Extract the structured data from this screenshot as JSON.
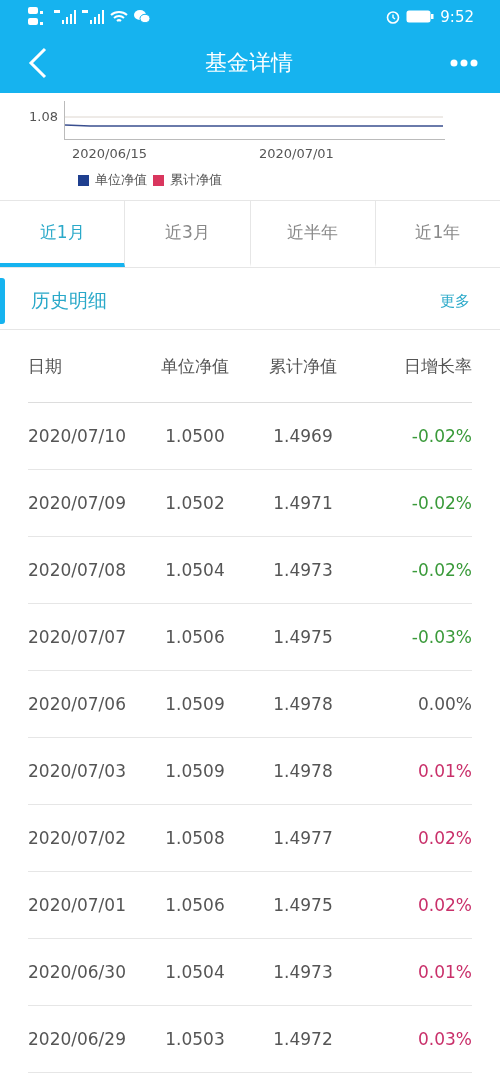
{
  "status_bar": {
    "time": "9:52"
  },
  "header": {
    "title": "基金详情"
  },
  "chart": {
    "y_tick": "1.08",
    "x_labels": [
      "2020/06/15",
      "2020/07/01"
    ],
    "legend": [
      {
        "label": "单位净值",
        "color": "#1f3f8f"
      },
      {
        "label": "累计净值",
        "color": "#d9365e"
      }
    ]
  },
  "tabs": [
    {
      "label": "近1月",
      "selected": true
    },
    {
      "label": "近3月",
      "selected": false
    },
    {
      "label": "近半年",
      "selected": false
    },
    {
      "label": "近1年",
      "selected": false
    }
  ],
  "section": {
    "title": "历史明细",
    "more": "更多"
  },
  "table": {
    "columns": [
      "日期",
      "单位净值",
      "累计净值",
      "日增长率"
    ],
    "rows": [
      {
        "date": "2020/07/10",
        "unit": "1.0500",
        "total": "1.4969",
        "rate": "-0.02%",
        "kind": "down"
      },
      {
        "date": "2020/07/09",
        "unit": "1.0502",
        "total": "1.4971",
        "rate": "-0.02%",
        "kind": "down"
      },
      {
        "date": "2020/07/08",
        "unit": "1.0504",
        "total": "1.4973",
        "rate": "-0.02%",
        "kind": "down"
      },
      {
        "date": "2020/07/07",
        "unit": "1.0506",
        "total": "1.4975",
        "rate": "-0.03%",
        "kind": "down"
      },
      {
        "date": "2020/07/06",
        "unit": "1.0509",
        "total": "1.4978",
        "rate": "0.00%",
        "kind": "flat"
      },
      {
        "date": "2020/07/03",
        "unit": "1.0509",
        "total": "1.4978",
        "rate": "0.01%",
        "kind": "up"
      },
      {
        "date": "2020/07/02",
        "unit": "1.0508",
        "total": "1.4977",
        "rate": "0.02%",
        "kind": "up"
      },
      {
        "date": "2020/07/01",
        "unit": "1.0506",
        "total": "1.4975",
        "rate": "0.02%",
        "kind": "up"
      },
      {
        "date": "2020/06/30",
        "unit": "1.0504",
        "total": "1.4973",
        "rate": "0.01%",
        "kind": "up"
      },
      {
        "date": "2020/06/29",
        "unit": "1.0503",
        "total": "1.4972",
        "rate": "0.03%",
        "kind": "up"
      }
    ]
  }
}
